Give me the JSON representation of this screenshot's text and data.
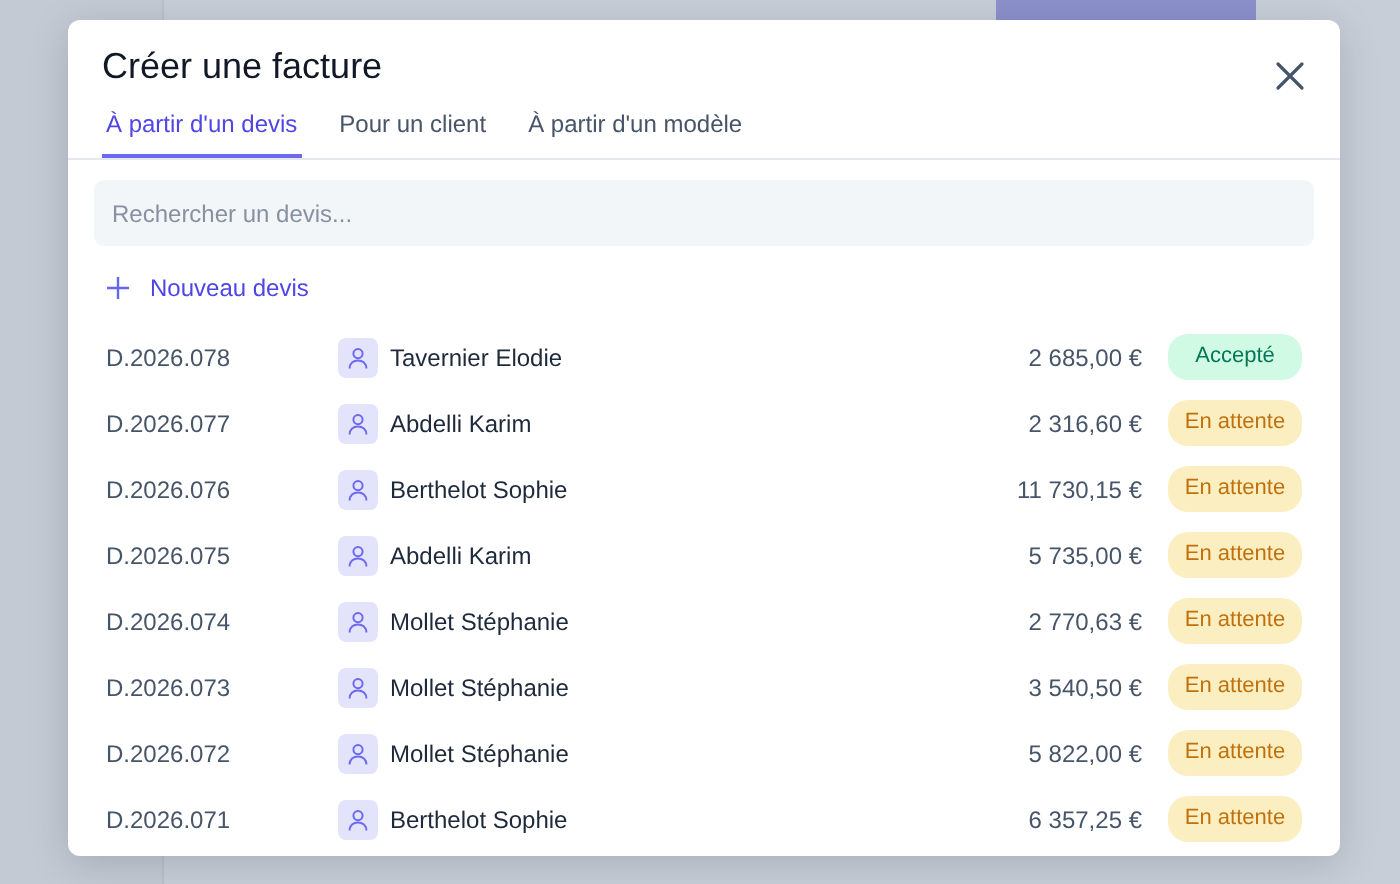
{
  "dialog": {
    "title": "Créer une facture"
  },
  "tabs": [
    {
      "label": "À partir d'un devis",
      "selected": true
    },
    {
      "label": "Pour un client",
      "selected": false
    },
    {
      "label": "À partir d'un modèle",
      "selected": false
    }
  ],
  "search": {
    "placeholder": "Rechercher un devis..."
  },
  "new_button": {
    "label": "Nouveau devis"
  },
  "quotes": [
    {
      "number": "D.2026.078",
      "client": "Tavernier Elodie",
      "amount": "2 685,00 €",
      "status": "Accepté",
      "kind": "accepted"
    },
    {
      "number": "D.2026.077",
      "client": "Abdelli Karim",
      "amount": "2 316,60 €",
      "status": "En attente",
      "kind": "pending"
    },
    {
      "number": "D.2026.076",
      "client": "Berthelot Sophie",
      "amount": "11 730,15 €",
      "status": "En attente",
      "kind": "pending"
    },
    {
      "number": "D.2026.075",
      "client": "Abdelli Karim",
      "amount": "5 735,00 €",
      "status": "En attente",
      "kind": "pending"
    },
    {
      "number": "D.2026.074",
      "client": "Mollet Stéphanie",
      "amount": "2 770,63 €",
      "status": "En attente",
      "kind": "pending"
    },
    {
      "number": "D.2026.073",
      "client": "Mollet Stéphanie",
      "amount": "3 540,50 €",
      "status": "En attente",
      "kind": "pending"
    },
    {
      "number": "D.2026.072",
      "client": "Mollet Stéphanie",
      "amount": "5 822,00 €",
      "status": "En attente",
      "kind": "pending"
    },
    {
      "number": "D.2026.071",
      "client": "Berthelot Sophie",
      "amount": "6 357,25 €",
      "status": "En attente",
      "kind": "pending"
    }
  ]
}
